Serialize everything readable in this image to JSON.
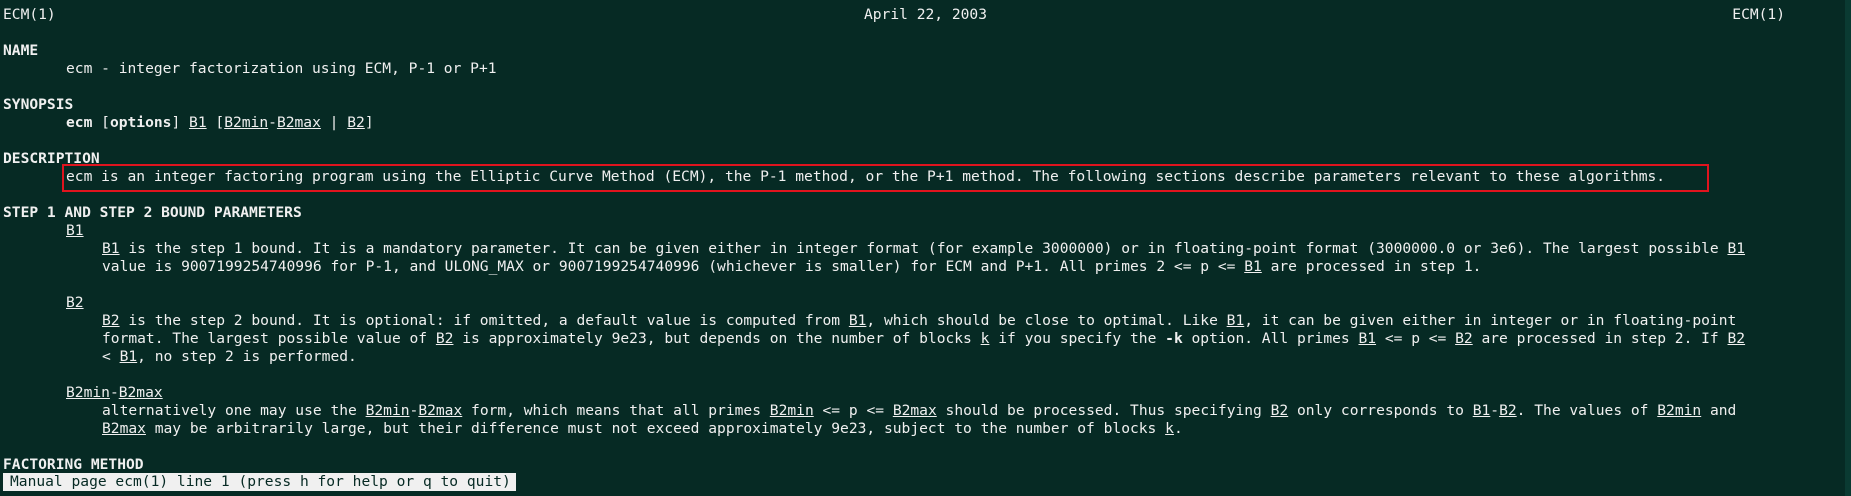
{
  "header": {
    "left": "ECM(1)",
    "center": "April 22, 2003",
    "right": "ECM(1)"
  },
  "name_section": {
    "heading": "NAME",
    "text": "ecm - integer factorization using ECM, P-1 or P+1"
  },
  "synopsis": {
    "heading": "SYNOPSIS",
    "cmd": "ecm",
    "open_bracket": "[",
    "options": "options",
    "close_bracket_space": "] ",
    "b1": "B1",
    "open2": " [",
    "b2min": "B2min",
    "dash": "-",
    "b2max": "B2max",
    "pipe": " | ",
    "b2": "B2",
    "close2": "]"
  },
  "description": {
    "heading": "DESCRIPTION",
    "text": "ecm is an integer factoring program using the Elliptic Curve Method (ECM), the P-1 method, or the P+1 method. The following sections describe parameters relevant to these algorithms."
  },
  "step_params": {
    "heading": "STEP 1 AND STEP 2 BOUND PARAMETERS",
    "b1_term": "B1",
    "b1_l1a": "B1",
    "b1_l1b": " is the step 1 bound. It is a mandatory parameter. It can be given either in integer format (for example 3000000) or in floating-point format (3000000.0 or 3e6). The largest possible ",
    "b1_l1c": "B1",
    "b1_l2a": "value is 9007199254740996 for P-1, and ULONG_MAX or 9007199254740996 (whichever is smaller) for ECM and P+1. All primes 2 <= p <= ",
    "b1_l2b": "B1",
    "b1_l2c": " are processed in step 1.",
    "b2_term": "B2",
    "b2_l1a": "B2",
    "b2_l1b": " is the step 2 bound. It is optional: if omitted, a default value is computed from ",
    "b2_l1c": "B1",
    "b2_l1d": ", which should be close to optimal. Like ",
    "b2_l1e": "B1",
    "b2_l1f": ", it can be given either in integer or in floating-point",
    "b2_l2a": "format. The largest possible value of ",
    "b2_l2b": "B2",
    "b2_l2c": " is approximately 9e23, but depends on the number of blocks ",
    "b2_l2d": "k",
    "b2_l2e": " if you specify the ",
    "b2_l2f": "-k",
    "b2_l2g": " option. All primes ",
    "b2_l2h": "B1",
    "b2_l2i": " <= p <= ",
    "b2_l2j": "B2",
    "b2_l2k": " are processed in step 2. If ",
    "b2_l2l": "B2",
    "b2_l3a": "< ",
    "b2_l3b": "B1",
    "b2_l3c": ", no step 2 is performed.",
    "range_term_a": "B2min",
    "range_term_b": "-",
    "range_term_c": "B2max",
    "r_l1a": "alternatively one may use the ",
    "r_l1b": "B2min",
    "r_l1c": "-",
    "r_l1d": "B2max",
    "r_l1e": " form, which means that all primes ",
    "r_l1f": "B2min",
    "r_l1g": " <= p <= ",
    "r_l1h": "B2max",
    "r_l1i": " should be processed. Thus specifying ",
    "r_l1j": "B2",
    "r_l1k": " only corresponds to ",
    "r_l1l": "B1",
    "r_l1m": "-",
    "r_l1n": "B2",
    "r_l1o": ". The values of ",
    "r_l1p": "B2min",
    "r_l1q": " and",
    "r_l2a": "B2max",
    "r_l2b": " may be arbitrarily large, but their difference must not exceed approximately 9e23, subject to the number of blocks ",
    "r_l2c": "k",
    "r_l2d": "."
  },
  "factoring": {
    "heading": "FACTORING METHOD"
  },
  "status_bar": {
    "text": "Manual page ecm(1) line 1 (press h for help or q to quit)"
  },
  "colors": {
    "background": "#062a24",
    "foreground": "#f0f0f0",
    "highlight_border": "#e0141e"
  }
}
